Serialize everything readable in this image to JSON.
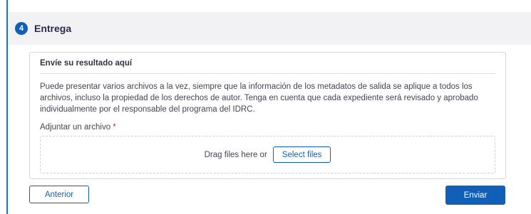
{
  "section": {
    "step_number": "4",
    "title": "Entrega"
  },
  "card": {
    "title": "Envíe su resultado aquí",
    "description": "Puede presentar varios archivos a la vez, siempre que la información de los metadatos de salida se aplique a todos los archivos, incluso la propiedad de los derechos de autor. Tenga en cuenta que cada expediente será revisado y aprobado individualmente por el responsable del programa del IDRC.",
    "attach_label": "Adjuntar un archivo",
    "required_mark": "*",
    "dropzone": {
      "text": "Drag files here or",
      "button_label": "Select files"
    }
  },
  "actions": {
    "previous_label": "Anterior",
    "submit_label": "Enviar"
  },
  "colors": {
    "primary": "#1160b7",
    "header_bg": "#f2f2f4",
    "required": "#d21f2a"
  }
}
